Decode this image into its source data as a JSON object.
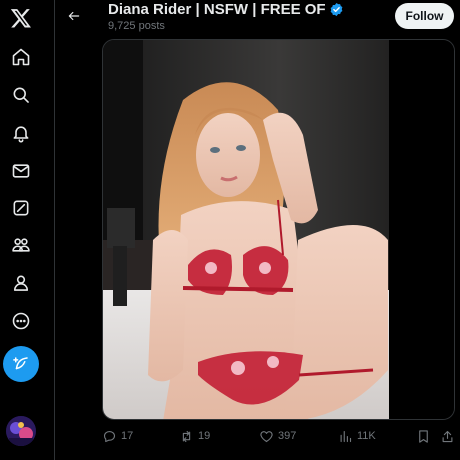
{
  "nav": {
    "items": [
      {
        "name": "x-logo-icon"
      },
      {
        "name": "home-icon"
      },
      {
        "name": "search-icon"
      },
      {
        "name": "notifications-bell-icon"
      },
      {
        "name": "messages-envelope-icon"
      },
      {
        "name": "grok-icon"
      },
      {
        "name": "communities-icon"
      },
      {
        "name": "profile-icon"
      },
      {
        "name": "more-circle-icon"
      }
    ],
    "post_button": {
      "icon": "feather-plus-icon"
    },
    "accent_color": "#1d9bf0"
  },
  "header": {
    "back_icon": "back-arrow-icon",
    "title": "Diana Rider | NSFW | FREE OF",
    "verified_icon": "verified-badge-icon",
    "post_count": "9,725 posts",
    "follow_label": "Follow"
  },
  "media": {
    "type": "photo"
  },
  "actions": {
    "reply_count": "17",
    "repost_count": "19",
    "like_count": "397",
    "views_count": "11K",
    "bookmark_icon": "bookmark-icon",
    "share_icon": "share-icon"
  },
  "colors": {
    "background": "#000000",
    "text_primary": "#e7e9ea",
    "text_secondary": "#71767b",
    "verified": "#1d9bf0"
  }
}
